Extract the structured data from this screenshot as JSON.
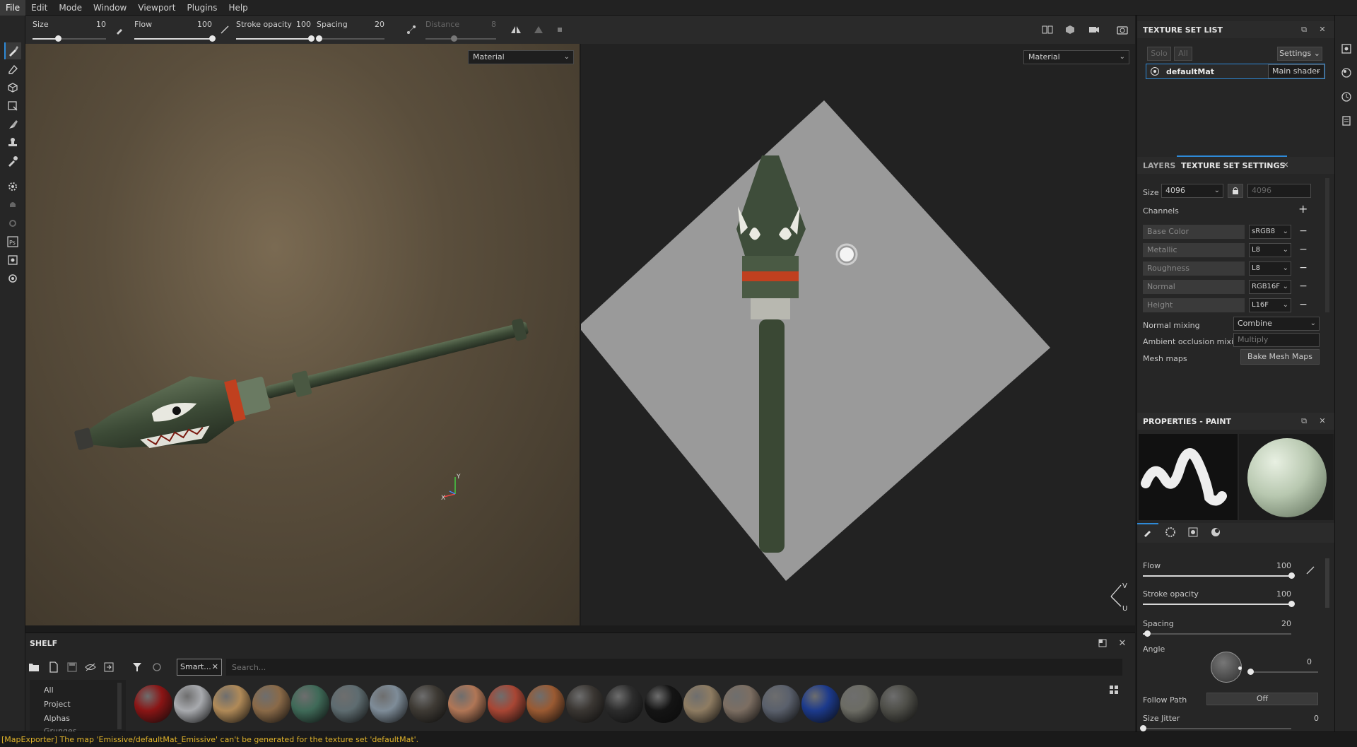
{
  "menu": [
    "File",
    "Edit",
    "Mode",
    "Window",
    "Viewport",
    "Plugins",
    "Help"
  ],
  "toolbar": {
    "size": {
      "label": "Size",
      "value": "10",
      "fraction": 0.35
    },
    "flow": {
      "label": "Flow",
      "value": "100",
      "fraction": 1.0
    },
    "stroke_opacity": {
      "label": "Stroke opacity",
      "value": "100",
      "fraction": 1.0
    },
    "spacing": {
      "label": "Spacing",
      "value": "20",
      "fraction": 0.03
    },
    "distance": {
      "label": "Distance",
      "value": "8",
      "fraction": 0.4
    }
  },
  "viewport3d": {
    "mode": "Material"
  },
  "viewport2d": {
    "mode": "Material"
  },
  "shelf": {
    "title": "SHELF",
    "filter_tag": "Smart...",
    "search_placeholder": "Search...",
    "categories": [
      "All",
      "Project",
      "Alphas",
      "Grunges"
    ],
    "materials": [
      {
        "color": "#8a1515"
      },
      {
        "color": "#a8aaae"
      },
      {
        "color": "#b08a58"
      },
      {
        "color": "#8a6a48"
      },
      {
        "color": "#3f6a58"
      },
      {
        "color": "#5e6c70"
      },
      {
        "color": "#7e8c98"
      },
      {
        "color": "#3e3a34"
      },
      {
        "color": "#b07656"
      },
      {
        "color": "#a84634"
      },
      {
        "color": "#9a5a32"
      },
      {
        "color": "#3a3632"
      },
      {
        "color": "#2c2c2c"
      },
      {
        "color": "#141414"
      },
      {
        "color": "#8e7c62"
      },
      {
        "color": "#7c6e62"
      },
      {
        "color": "#5a606c"
      },
      {
        "color": "#1c3a8c"
      },
      {
        "color": "#6c6c64"
      },
      {
        "color": "#4e4e48"
      }
    ]
  },
  "status": {
    "message": "[MapExporter] The map 'Emissive/defaultMat_Emissive' can't be generated for the texture set 'defaultMat'."
  },
  "texture_set_list": {
    "title": "TEXTURE SET LIST",
    "solo": "Solo",
    "all": "All",
    "settings": "Settings",
    "item_name": "defaultMat",
    "shader": "Main shader"
  },
  "texture_set_settings": {
    "tab_layers": "LAYERS",
    "tab_settings": "TEXTURE SET SETTINGS",
    "size_label": "Size",
    "size_value": "4096",
    "size_linked": "4096",
    "channels_label": "Channels",
    "channels": [
      {
        "name": "Base Color",
        "format": "sRGB8"
      },
      {
        "name": "Metallic",
        "format": "L8"
      },
      {
        "name": "Roughness",
        "format": "L8"
      },
      {
        "name": "Normal",
        "format": "RGB16F"
      },
      {
        "name": "Height",
        "format": "L16F"
      }
    ],
    "normal_mixing_label": "Normal mixing",
    "normal_mixing_value": "Combine",
    "ao_mixing_label": "Ambient occlusion mixing",
    "ao_mixing_value": "Multiply",
    "mesh_maps_label": "Mesh maps",
    "bake_button": "Bake Mesh Maps"
  },
  "properties": {
    "title": "PROPERTIES - PAINT",
    "flow": {
      "label": "Flow",
      "value": "100",
      "fraction": 1.0
    },
    "stroke_opacity": {
      "label": "Stroke opacity",
      "value": "100",
      "fraction": 1.0
    },
    "spacing": {
      "label": "Spacing",
      "value": "20",
      "fraction": 0.03
    },
    "angle_label": "Angle",
    "angle_value": "0",
    "follow_path_label": "Follow Path",
    "follow_path_value": "Off",
    "size_jitter_label": "Size Jitter",
    "size_jitter_value": "0"
  },
  "colors": {
    "accent": "#2e8ad8",
    "status_warning": "#e0b32a"
  }
}
